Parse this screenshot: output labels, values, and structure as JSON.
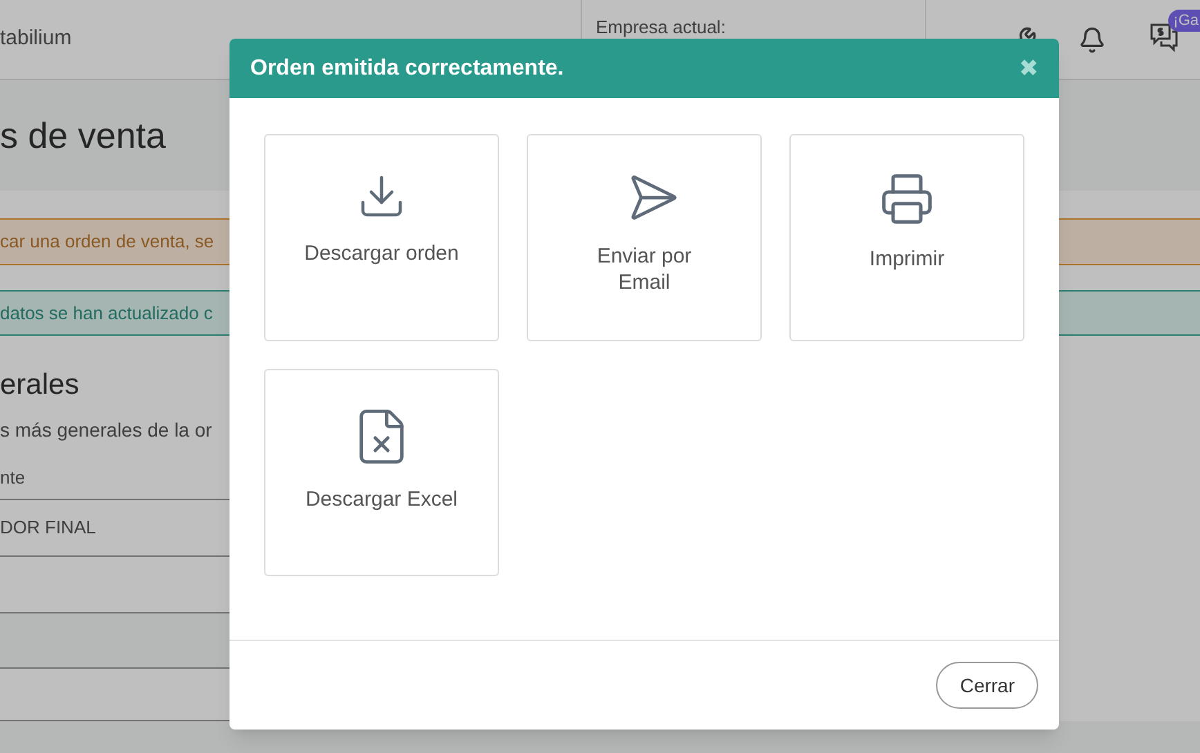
{
  "header": {
    "brand": "tabilium",
    "company_label": "Empresa actual:",
    "badge": "¡Ga"
  },
  "page": {
    "title": "s de venta",
    "warning": "car una orden de venta, se",
    "success": "datos se han actualizado c",
    "section_title": "erales",
    "section_subtitle": "s más generales de la or",
    "field_label": "nte",
    "field_value": "DOR FINAL"
  },
  "dialog": {
    "title": "Orden emitida correctamente.",
    "close": "✖",
    "options": [
      {
        "kind": "download",
        "label": "Descargar orden"
      },
      {
        "kind": "send",
        "label": "Enviar por Email"
      },
      {
        "kind": "print",
        "label": "Imprimir"
      },
      {
        "kind": "excel",
        "label": "Descargar Excel"
      }
    ],
    "footer_button": "Cerrar"
  }
}
